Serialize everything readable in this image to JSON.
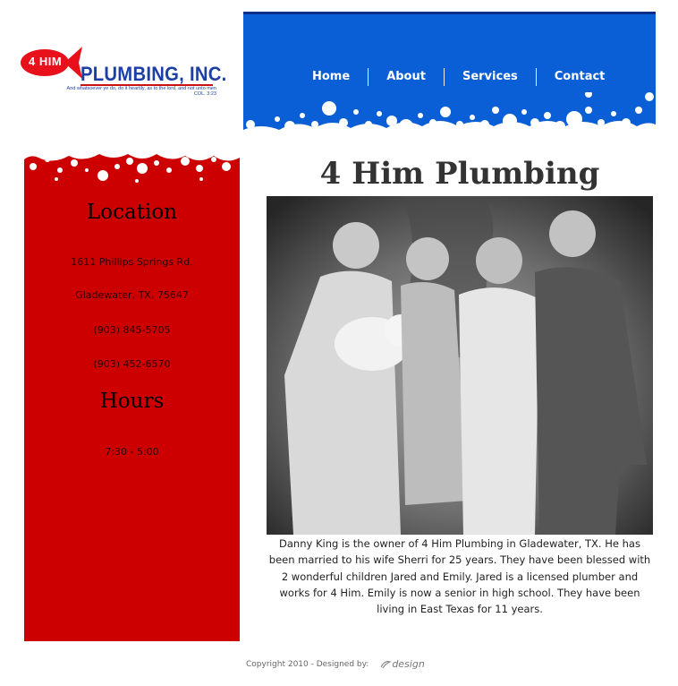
{
  "logo": {
    "badge_text": "4 HIM",
    "company_name": "PLUMBING, INC.",
    "verse": "And whatsoever ye do, do it heartily, as to the lord, and not unto men",
    "verse_ref": "COL. 3:23",
    "colors": {
      "fish": "#e8101a",
      "name": "#1b3fa6"
    }
  },
  "nav": {
    "items": [
      {
        "label": "Home"
      },
      {
        "label": "About"
      },
      {
        "label": "Services"
      },
      {
        "label": "Contact"
      }
    ]
  },
  "sidebar": {
    "location_heading": "Location",
    "address_line1": "1611 Phillips Springs Rd.",
    "address_line2": "Gladewater, TX. 75647",
    "phone1": "(903) 845-5705",
    "phone2": "(903) 452-6570",
    "hours_heading": "Hours",
    "hours": "7:30 - 5:00"
  },
  "main": {
    "title": "4 Him Plumbing",
    "bio": "Danny King is the owner of 4 Him Plumbing in Gladewater, TX. He has been married to his wife Sherri for 25 years. They have been blessed with 2 wonderful children Jared and Emily. Jared is a licensed plumber and works for 4 Him. Emily is now a senior in high school. They have been living in East Texas for 11 years."
  },
  "footer": {
    "copyright": "Copyright 2010 - Designed by:",
    "designer": "design"
  },
  "colors": {
    "header_blue": "#0b5fd6",
    "sidebar_red": "#cc0000"
  }
}
